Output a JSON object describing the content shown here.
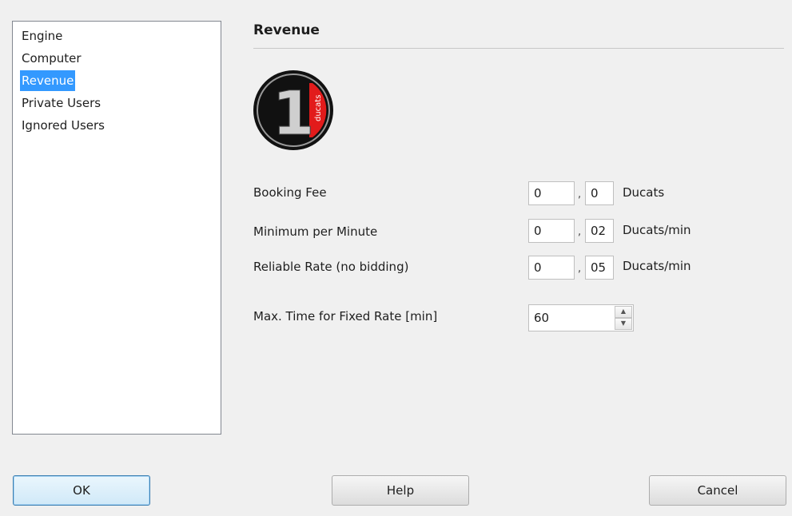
{
  "nav": {
    "items": [
      {
        "label": "Engine",
        "selected": false
      },
      {
        "label": "Computer",
        "selected": false
      },
      {
        "label": "Revenue",
        "selected": true
      },
      {
        "label": "Private Users",
        "selected": false
      },
      {
        "label": "Ignored Users",
        "selected": false
      }
    ]
  },
  "panel": {
    "title": "Revenue",
    "logo": {
      "icon": "ducats-coin-icon",
      "numeral": "1",
      "text": "ducats",
      "accent": "#e21b1b"
    },
    "fields": [
      {
        "label": "Booking Fee",
        "integer": "0",
        "decimal": "0",
        "unit": "Ducats"
      },
      {
        "label": "Minimum per Minute",
        "integer": "0",
        "decimal": "02",
        "unit": "Ducats/min"
      },
      {
        "label": "Reliable Rate (no bidding)",
        "integer": "0",
        "decimal": "05",
        "unit": "Ducats/min"
      }
    ],
    "separator": ",",
    "max_time": {
      "label": "Max. Time for Fixed Rate [min]",
      "value": "60"
    }
  },
  "buttons": {
    "ok": "OK",
    "help": "Help",
    "cancel": "Cancel"
  },
  "colors": {
    "selection": "#3399ff",
    "dialog_bg": "#f0f0f0"
  }
}
